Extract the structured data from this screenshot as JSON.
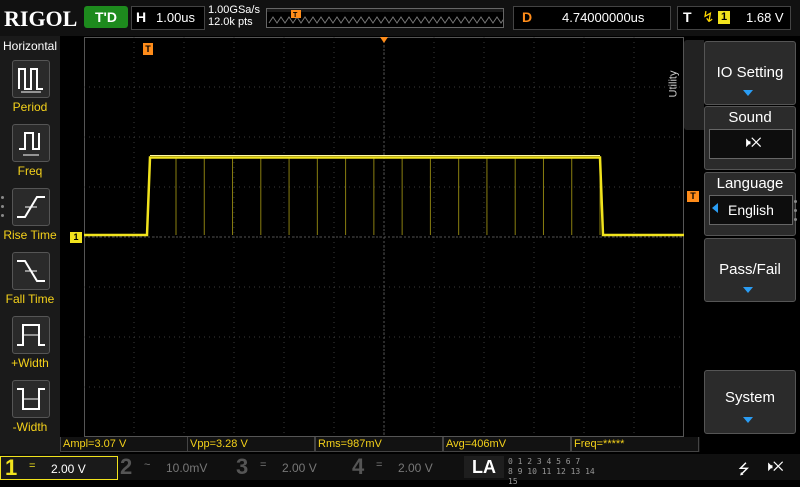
{
  "topbar": {
    "logo": "RIGOL",
    "run_state": "T'D",
    "horizontal_label": "H",
    "timebase": "1.00us",
    "sample_rate": "1.00GSa/s",
    "memory_depth": "12.0k pts",
    "delay_label": "D",
    "delay_value": "4.74000000us",
    "trigger_label": "T",
    "trigger_source": "1",
    "trigger_level": "1.68 V"
  },
  "left_menu": {
    "title": "Horizontal",
    "items": [
      {
        "label": "Period",
        "icon": "period-icon"
      },
      {
        "label": "Freq",
        "icon": "freq-icon"
      },
      {
        "label": "Rise Time",
        "icon": "rise-time-icon"
      },
      {
        "label": "Fall Time",
        "icon": "fall-time-icon"
      },
      {
        "label": "+Width",
        "icon": "pos-width-icon"
      },
      {
        "label": "-Width",
        "icon": "neg-width-icon"
      }
    ]
  },
  "right_menu": {
    "utility_tab": "Utility",
    "io_setting": "IO Setting",
    "sound": "Sound",
    "language": "Language",
    "language_value": "English",
    "pass_fail": "Pass/Fail",
    "system": "System"
  },
  "measurements": {
    "ampl": "Ampl=3.07 V",
    "vpp": "Vpp=3.28 V",
    "rms": "Rms=987mV",
    "avg": "Avg=406mV",
    "freq": "Freq=*****"
  },
  "channels": [
    {
      "num": "1",
      "coupling": "=",
      "scale": "2.00 V",
      "color": "#f1e31d",
      "active": true
    },
    {
      "num": "2",
      "coupling": "~",
      "scale": "10.0mV",
      "color": "#1fb3b3",
      "active": false
    },
    {
      "num": "3",
      "coupling": "=",
      "scale": "2.00 V",
      "color": "#d11fd1",
      "active": false
    },
    {
      "num": "4",
      "coupling": "=",
      "scale": "2.00 V",
      "color": "#1f6bd1",
      "active": false
    }
  ],
  "la": {
    "label": "LA",
    "digits_row1": "0 1 2 3   4 5 6 7",
    "digits_row2": "8 9 10 11 12 13 14 15"
  },
  "waveform": {
    "channel_marker": "1",
    "trigger_marker": "T",
    "high_level_fraction": 0.62,
    "low_level_fraction": 0.0,
    "ghost_edges": 16
  },
  "colors": {
    "ch1": "#f1e31d",
    "trigger": "#ff8c1a",
    "grid": "#3a3a3a",
    "accent_blue": "#2a9df4"
  }
}
